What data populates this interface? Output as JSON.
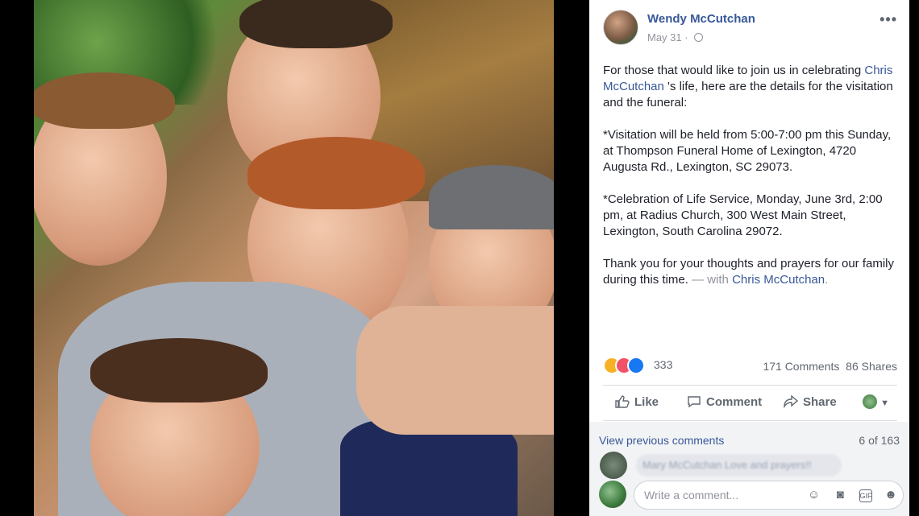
{
  "post": {
    "author": "Wendy McCutchan",
    "date": "May 31",
    "date_separator": "·",
    "more_label": "•••",
    "body": {
      "p1_pre": "For those that would like to join us in celebrating",
      "p1_link": "Chris McCutchan",
      "p1_post": " 's life, here are the details for the visitation and the funeral:",
      "p2": "*Visitation will be held from 5:00-7:00 pm this Sunday, at Thompson Funeral Home of Lexington, 4720 Augusta Rd., Lexington, SC 29073.",
      "p3": "*Celebration of Life Service, Monday, June 3rd, 2:00 pm, at Radius Church, 300 West Main Street, Lexington, South Carolina 29072.",
      "p4_pre": "Thank you for your thoughts and prayers for our family during this time.",
      "p4_with": " — with ",
      "p4_link": "Chris McCutchan",
      "p4_end": "."
    },
    "reactions": {
      "count": "333",
      "comments": "171 Comments",
      "shares": "86 Shares",
      "icons": [
        "sad-icon",
        "love-icon",
        "like-icon"
      ]
    },
    "actions": {
      "like": "Like",
      "comment": "Comment",
      "share": "Share"
    },
    "comments": {
      "view_previous": "View previous comments",
      "count": "6 of 163",
      "blurred_comment": "Mary McCutchan Love and prayers!!",
      "write_placeholder": "Write a comment..."
    }
  },
  "colors": {
    "link": "#385898",
    "muted": "#90949c",
    "text": "#1d2129"
  }
}
